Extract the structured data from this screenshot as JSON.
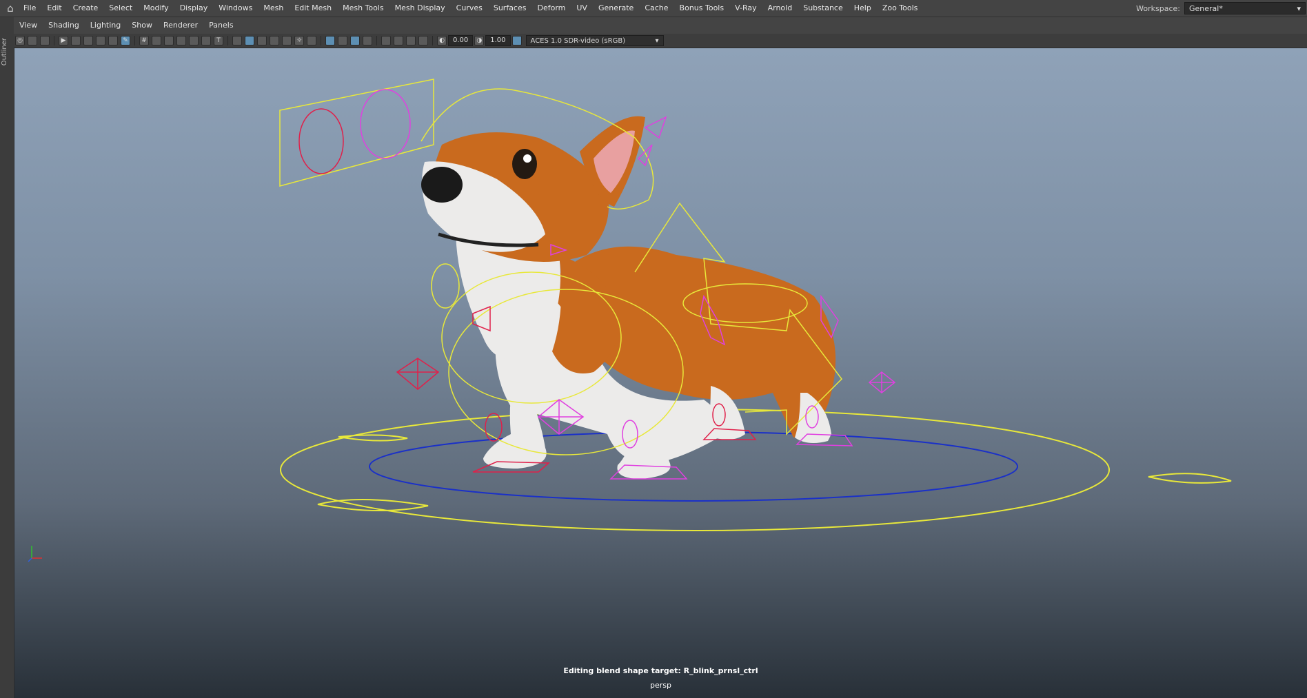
{
  "menu": {
    "items": [
      "File",
      "Edit",
      "Create",
      "Select",
      "Modify",
      "Display",
      "Windows",
      "Mesh",
      "Edit Mesh",
      "Mesh Tools",
      "Mesh Display",
      "Curves",
      "Surfaces",
      "Deform",
      "UV",
      "Generate",
      "Cache",
      "Bonus Tools",
      "V-Ray",
      "Arnold",
      "Substance",
      "Help",
      "Zoo Tools"
    ]
  },
  "workspace": {
    "label": "Workspace:",
    "value": "General*"
  },
  "outliner": {
    "label": "Outliner"
  },
  "panel_menu": {
    "items": [
      "View",
      "Shading",
      "Lighting",
      "Show",
      "Renderer",
      "Panels"
    ]
  },
  "viewport_toolbar": {
    "exposure": "0.00",
    "gamma": "1.00",
    "colorspace": "ACES 1.0 SDR-video (sRGB)"
  },
  "viewport": {
    "status_text": "Editing blend shape target: R_blink_prnsl_ctrl",
    "camera": "persp"
  },
  "colors": {
    "control_yellow": "#e8e83a",
    "control_magenta": "#e040e0",
    "control_red": "#e0204a",
    "control_blue": "#1a30c8",
    "fur_orange": "#c96a1e",
    "fur_white": "#ecebea"
  }
}
